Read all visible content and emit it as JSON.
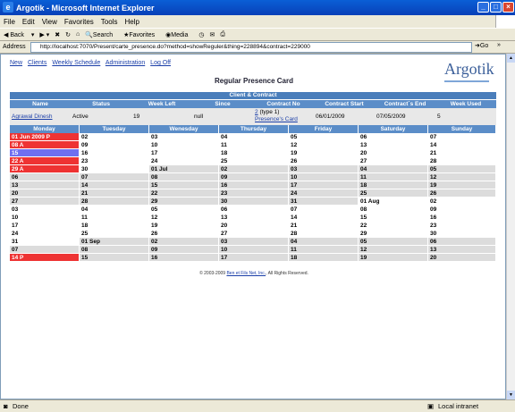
{
  "window": {
    "title": "Argotik - Microsoft Internet Explorer"
  },
  "menu": [
    "File",
    "Edit",
    "View",
    "Favorites",
    "Tools",
    "Help"
  ],
  "toolbar": {
    "back": "Back",
    "search": "Search",
    "favorites": "Favorites",
    "media": "Media"
  },
  "address": {
    "label": "Address",
    "url": "http://localhost:7070/Present/carte_presence.do?method=showReguler&thing=228894&contract=229000",
    "go": "Go"
  },
  "nav": [
    "New",
    "Clients",
    "Weekly Schedule",
    "Administration",
    "Log Off"
  ],
  "logo": "Argotik",
  "page_title": "Regular Presence Card",
  "client_contract": {
    "section_title": "Client & Contract",
    "headers": [
      "Name",
      "Status",
      "Week Left",
      "Since",
      "Contract No",
      "Contract Start",
      "Contract`s End",
      "Week Used"
    ],
    "row": {
      "name": "Agrawal Dinesh",
      "status": "Active",
      "week_left": "19",
      "since": "null",
      "contract_no": "2",
      "contract_type": "(type 1)",
      "presence_card": "Presence's Card",
      "contract_start": "06/01/2009",
      "contract_end": "07/05/2009",
      "week_used": "5"
    }
  },
  "calendar": {
    "days": [
      "Monday",
      "Tuesday",
      "Wenesday",
      "Thursday",
      "Friday",
      "Saturday",
      "Sunday"
    ],
    "weeks": [
      [
        "01 Jun 2009  P",
        "02",
        "03",
        "04",
        "05",
        "06",
        "07"
      ],
      [
        "08  A",
        "09",
        "10",
        "11",
        "12",
        "13",
        "14"
      ],
      [
        "15",
        "16",
        "17",
        "18",
        "19",
        "20",
        "21"
      ],
      [
        "22  A",
        "23",
        "24",
        "25",
        "26",
        "27",
        "28"
      ],
      [
        "29  A",
        "30",
        "01 Jul",
        "02",
        "03",
        "04",
        "05"
      ],
      [
        "06",
        "07",
        "08",
        "09",
        "10",
        "11",
        "12"
      ],
      [
        "13",
        "14",
        "15",
        "16",
        "17",
        "18",
        "19"
      ],
      [
        "20",
        "21",
        "22",
        "23",
        "24",
        "25",
        "26"
      ],
      [
        "27",
        "28",
        "29",
        "30",
        "31",
        "01 Aug",
        "02"
      ],
      [
        "03",
        "04",
        "05",
        "06",
        "07",
        "08",
        "09"
      ],
      [
        "10",
        "11",
        "12",
        "13",
        "14",
        "15",
        "16"
      ],
      [
        "17",
        "18",
        "19",
        "20",
        "21",
        "22",
        "23"
      ],
      [
        "24",
        "25",
        "26",
        "27",
        "28",
        "29",
        "30"
      ],
      [
        "31",
        "01 Sep",
        "02",
        "03",
        "04",
        "05",
        "06"
      ],
      [
        "07",
        "08",
        "09",
        "10",
        "11",
        "12",
        "13"
      ],
      [
        "14  P",
        "15",
        "16",
        "17",
        "18",
        "19",
        "20"
      ]
    ],
    "colors": {
      "present": "#ee3333",
      "absent": "#ee3333",
      "highlight": "#6f6ff0",
      "white": "#ffffff",
      "grey": "#dcdcdc"
    }
  },
  "footer": {
    "prefix": "© 2003-2009",
    "company": "Ben et Fils Net, Inc.",
    "suffix": ", All Rights Reserved."
  },
  "status": {
    "left": "Done",
    "right": "Local intranet"
  }
}
